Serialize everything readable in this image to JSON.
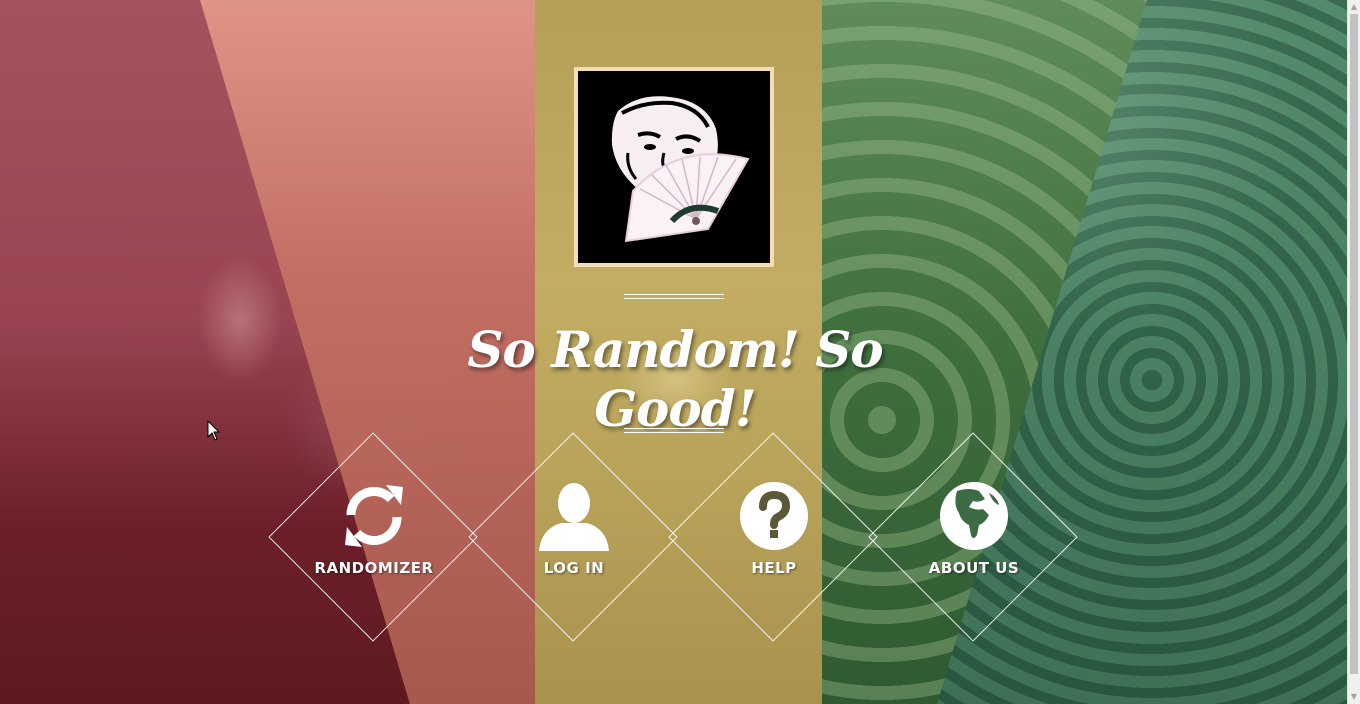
{
  "tagline": "So Random!  So Good!",
  "nav": [
    {
      "label": "RANDOMIZER",
      "icon": "refresh-icon"
    },
    {
      "label": "LOG IN",
      "icon": "user-icon"
    },
    {
      "label": "HELP",
      "icon": "question-icon"
    },
    {
      "label": "ABOUT US",
      "icon": "globe-icon"
    }
  ],
  "colors": {
    "maroon": "#5e1a20",
    "salmon": "#e59a8a",
    "mustard": "#b8a25a",
    "green": "#3f6e3d",
    "teal_green": "#3d7558",
    "logo_border": "#f5ddb8"
  }
}
